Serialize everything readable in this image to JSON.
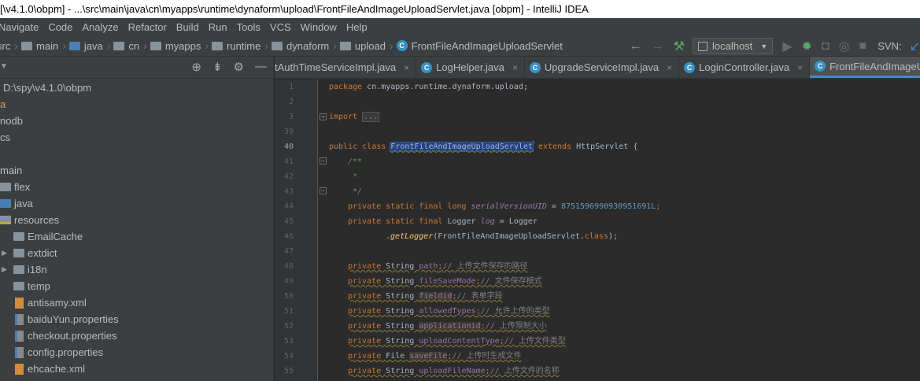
{
  "window": {
    "title": "[\\v4.1.0\\obpm] - ...\\src\\main\\java\\cn\\myapps\\runtime\\dynaform\\upload\\FrontFileAndImageUploadServlet.java [obpm] - IntelliJ IDEA"
  },
  "menu": [
    "Navigate",
    "Code",
    "Analyze",
    "Refactor",
    "Build",
    "Run",
    "Tools",
    "VCS",
    "Window",
    "Help"
  ],
  "breadcrumb": {
    "items": [
      "src",
      "main",
      "java",
      "cn",
      "myapps",
      "runtime",
      "dynaform",
      "upload"
    ],
    "class_name": "FrontFileAndImageUploadServlet"
  },
  "toolbar": {
    "run_config": "localhost",
    "svn_label": "SVN:"
  },
  "project": {
    "root_path": "D:\\spy\\v4.1.0\\obpm",
    "rows": [
      {
        "label": "a"
      },
      {
        "label": "nodb"
      },
      {
        "label": "cs"
      },
      {
        "label": "main"
      },
      {
        "label": "flex"
      },
      {
        "label": "java"
      },
      {
        "label": "resources"
      },
      {
        "label": "EmailCache"
      },
      {
        "label": "extdict"
      },
      {
        "label": "i18n"
      },
      {
        "label": "temp"
      },
      {
        "label": "antisamy.xml"
      },
      {
        "label": "baiduYun.properties"
      },
      {
        "label": "checkout.properties"
      },
      {
        "label": "config.properties"
      },
      {
        "label": "ehcache.xml"
      }
    ]
  },
  "tabs": [
    {
      "label": "tAuthTimeServiceImpl.java"
    },
    {
      "label": "LogHelper.java"
    },
    {
      "label": "UpgradeServiceImpl.java"
    },
    {
      "label": "LoginController.java"
    },
    {
      "label": "FrontFileAndImageUp"
    }
  ],
  "editor": {
    "line_numbers": [
      "1",
      "2",
      "3",
      "39",
      "40",
      "41",
      "42",
      "43",
      "44",
      "45",
      "46",
      "47",
      "48",
      "49",
      "50",
      "51",
      "52",
      "53",
      "54",
      "55"
    ],
    "code": {
      "package_kw": "package",
      "package_name": " cn.myapps.runtime.dynaform.upload;",
      "import_kw": "import",
      "import_fold": "...",
      "public_class_kw": "public class ",
      "class_name": "FrontFileAndImageUploadServlet",
      "extends_kw": " extends ",
      "super_class": "HttpServlet {",
      "doc_open": "/**",
      "doc_mid": " *",
      "doc_close": " */",
      "psf_long": "private static final long ",
      "serial_field": "serialVersionUID",
      "serial_eq": " = ",
      "serial_value": "8751596990930951691L",
      "semi": ";",
      "psf_logger": "private static final ",
      "logger_type": "Logger ",
      "log_field": "log",
      "logger_eq": " = Logger",
      "dot": ".",
      "get_logger": "getLogger",
      "get_logger_arg": "(FrontFileAndImageUploadServlet.",
      "class_kw": "class",
      "get_logger_end": ");",
      "fields": [
        {
          "mod": "private ",
          "type": "String ",
          "name": "path",
          "comment": "// 上传文件保存的路径"
        },
        {
          "mod": "private ",
          "type": "String ",
          "name": "fileSaveMode",
          "comment": "// 文件保存模式"
        },
        {
          "mod": "private ",
          "type": "String ",
          "name": "fieldid",
          "comment": "// 表单字段"
        },
        {
          "mod": "private ",
          "type": "String ",
          "name": "allowedTypes",
          "comment": "// 允许上传的类型"
        },
        {
          "mod": "private ",
          "type": "String ",
          "name": "applicationid",
          "comment": "// 上传限制大小"
        },
        {
          "mod": "private ",
          "type": "String ",
          "name": "uploadContentType",
          "comment": "// 上传文件类型"
        },
        {
          "mod": "private ",
          "type": "File ",
          "name": "saveFile",
          "comment": "// 上传时生成文件"
        },
        {
          "mod": "private ",
          "type": "String ",
          "name": "uploadFileName",
          "comment": "// 上传文件的名称"
        }
      ]
    }
  },
  "colors": {
    "editor_bg": "#2b2b2b",
    "panel_bg": "#3c3f41",
    "keyword": "#cc7832",
    "field": "#9876aa",
    "number": "#6897bb",
    "doc_comment": "#629755",
    "selection": "#214283",
    "tab_active_underline": "#4a88c7"
  }
}
